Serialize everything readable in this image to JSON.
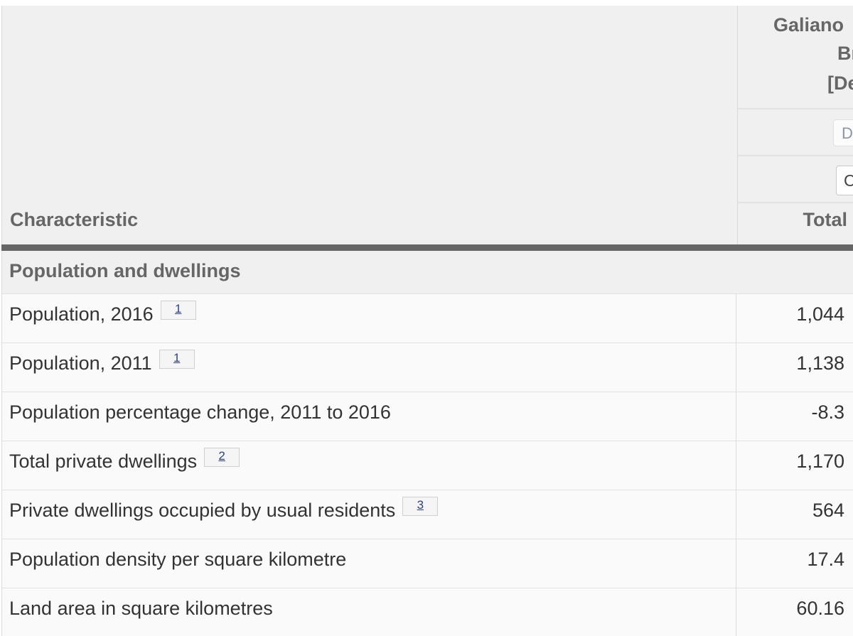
{
  "header": {
    "characteristic_label": "Characteristic",
    "geo_lines": [
      "Galiano",
      "Br",
      "[De"
    ],
    "control_1_label": "D",
    "control_2_label": "C",
    "total_label": "Total"
  },
  "section": {
    "title": "Population and dwellings"
  },
  "rows": [
    {
      "label": "Population, 2016",
      "footnote": "1",
      "value": "1,044"
    },
    {
      "label": "Population, 2011",
      "footnote": "1",
      "value": "1,138"
    },
    {
      "label": "Population percentage change, 2011 to 2016",
      "footnote": "",
      "value": "-8.3"
    },
    {
      "label": "Total private dwellings",
      "footnote": "2",
      "value": "1,170"
    },
    {
      "label": "Private dwellings occupied by usual residents",
      "footnote": "3",
      "value": "564"
    },
    {
      "label": "Population density per square kilometre",
      "footnote": "",
      "value": "17.4"
    },
    {
      "label": "Land area in square kilometres",
      "footnote": "",
      "value": "60.16"
    }
  ],
  "colors": {
    "header_bg": "#f0f0f0",
    "rule": "#666666",
    "row_bg": "#fafafa",
    "footnote_link": "#2a3f8f"
  }
}
